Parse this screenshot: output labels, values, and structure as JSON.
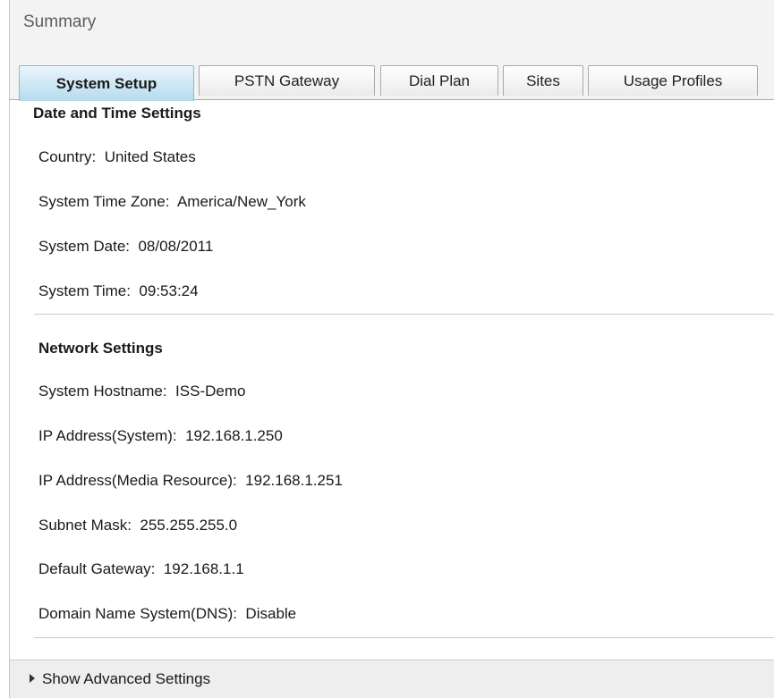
{
  "header": {
    "title": "Summary"
  },
  "tabs": [
    {
      "label": "System Setup",
      "active": true
    },
    {
      "label": "PSTN Gateway",
      "active": false
    },
    {
      "label": "Dial Plan",
      "active": false
    },
    {
      "label": "Sites",
      "active": false
    },
    {
      "label": "Usage Profiles",
      "active": false
    }
  ],
  "date_time": {
    "heading": "Date and Time Settings",
    "rows": [
      "Country:  United States",
      "System Time Zone:  America/New_York",
      "System Date:  08/08/2011",
      "System Time:  09:53:24"
    ]
  },
  "network": {
    "heading": "Network Settings",
    "rows": [
      "System Hostname:  ISS-Demo",
      "IP Address(System):  192.168.1.250",
      "IP Address(Media Resource):  192.168.1.251",
      "Subnet Mask:  255.255.255.0",
      "Default Gateway:  192.168.1.1",
      "Domain Name System(DNS):  Disable"
    ]
  },
  "advanced": {
    "label": "Show Advanced Settings",
    "icon": "triangle-right-icon"
  },
  "colors": {
    "active_tab": "#cde7f4",
    "header_bg": "#f3f3f3",
    "footer_bg": "#eeeeee"
  }
}
